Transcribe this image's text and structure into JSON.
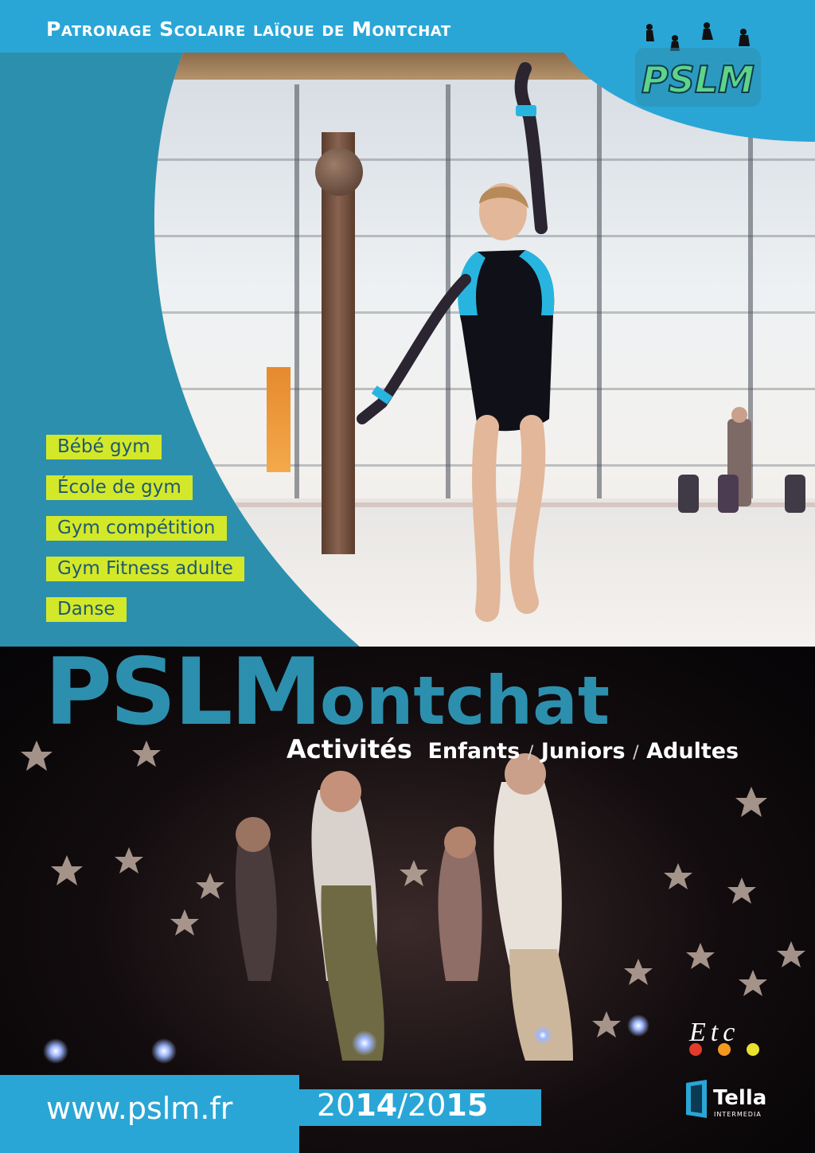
{
  "header": {
    "org_title": "Patronage Scolaire laïque de Montchat"
  },
  "logo": {
    "lettering": "PSLM",
    "icon": "dancers-logo-icon"
  },
  "activities": [
    "Bébé gym",
    "École de gym",
    "Gym compétition",
    "Gym Fitness adulte",
    "Danse"
  ],
  "brand": {
    "big": "PSLM",
    "small": "ontchat"
  },
  "tagline": {
    "lead": "Activités",
    "audiences": [
      "Enfants",
      "Juniors",
      "Adultes"
    ],
    "separator": "/"
  },
  "footer": {
    "url": "www.pslm.fr",
    "year": {
      "part1": "20",
      "part2": "14",
      "part3": "/20",
      "part4": "15"
    }
  },
  "sponsors": {
    "etc": "Etc",
    "tella": "Tella",
    "tella_sub": "INTERMEDIA"
  },
  "colors": {
    "accent_blue": "#2aa6d6",
    "panel_teal": "#2d8fae",
    "tag_yellow": "#d4e82a",
    "tag_text": "#1d5a70"
  }
}
